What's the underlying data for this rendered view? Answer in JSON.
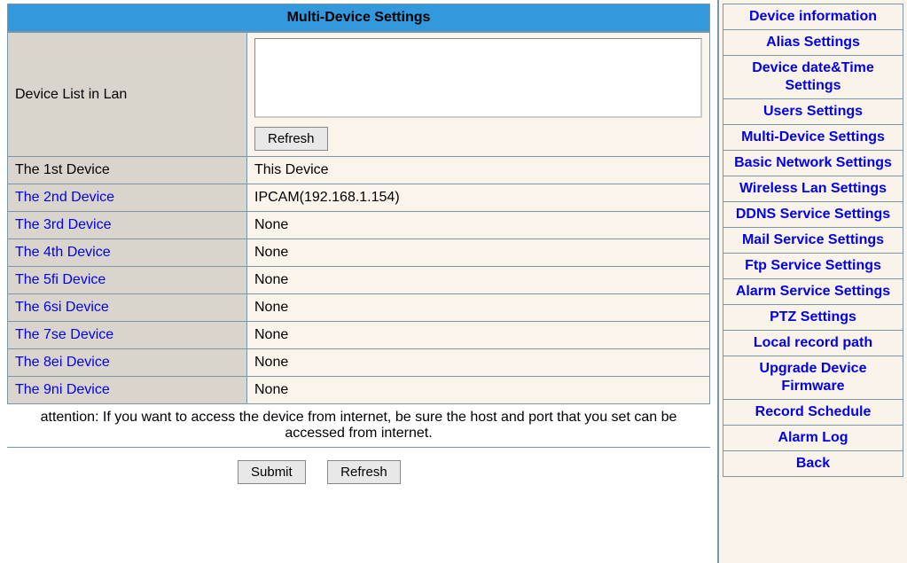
{
  "header": {
    "title": "Multi-Device Settings"
  },
  "deviceListLan": {
    "label": "Device List in Lan",
    "refreshLabel": "Refresh"
  },
  "devices": [
    {
      "label": "The 1st Device",
      "value": "This Device",
      "isLink": false
    },
    {
      "label": "The 2nd Device",
      "value": "IPCAM(192.168.1.154)",
      "isLink": true
    },
    {
      "label": "The 3rd Device",
      "value": "None",
      "isLink": true
    },
    {
      "label": "The 4th Device",
      "value": "None",
      "isLink": true
    },
    {
      "label": "The 5fi Device",
      "value": "None",
      "isLink": true
    },
    {
      "label": "The 6si Device",
      "value": "None",
      "isLink": true
    },
    {
      "label": "The 7se Device",
      "value": "None",
      "isLink": true
    },
    {
      "label": "The 8ei Device",
      "value": "None",
      "isLink": true
    },
    {
      "label": "The 9ni Device",
      "value": "None",
      "isLink": true
    }
  ],
  "attention": "attention: If you want to access the device from internet, be sure the host and port that you set can be accessed from internet.",
  "buttons": {
    "submit": "Submit",
    "refresh": "Refresh"
  },
  "sidebar": {
    "items": [
      "Device information",
      "Alias Settings",
      "Device date&Time Settings",
      "Users Settings",
      "Multi-Device Settings",
      "Basic Network Settings",
      "Wireless Lan Settings",
      "DDNS Service Settings",
      "Mail Service Settings",
      "Ftp Service Settings",
      "Alarm Service Settings",
      "PTZ Settings",
      "Local record path",
      "Upgrade Device Firmware",
      "Record Schedule",
      "Alarm Log",
      "Back"
    ]
  }
}
